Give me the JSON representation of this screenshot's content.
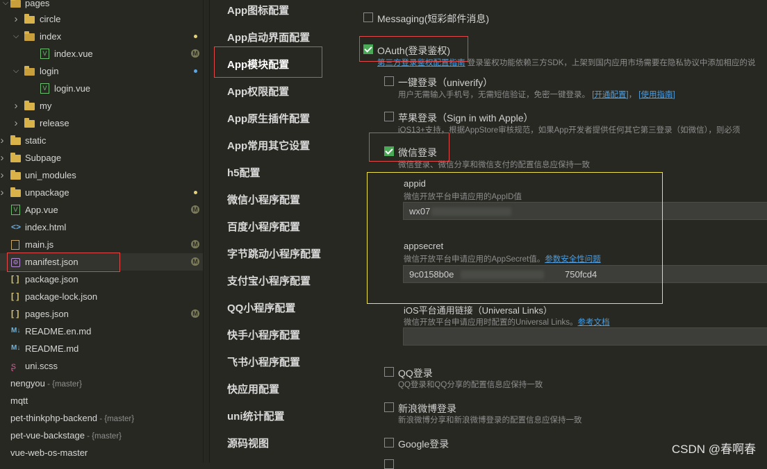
{
  "tree": {
    "items": [
      {
        "label": "pages",
        "icon": "folder-icon",
        "arrow": "chevron-down-icon",
        "open": true
      },
      {
        "label": "circle",
        "icon": "folder-icon",
        "arrow": "chevron-right-icon"
      },
      {
        "label": "index",
        "icon": "folder-icon",
        "arrow": "chevron-down-icon",
        "open": true
      },
      {
        "label": "index.vue",
        "icon": "vue-file-icon",
        "badge": "M"
      },
      {
        "label": "login",
        "icon": "folder-icon",
        "arrow": "chevron-down-icon",
        "open": true
      },
      {
        "label": "login.vue",
        "icon": "vue-file-icon"
      },
      {
        "label": "my",
        "icon": "folder-icon",
        "arrow": "chevron-right-icon"
      },
      {
        "label": "release",
        "icon": "folder-icon",
        "arrow": "chevron-right-icon"
      },
      {
        "label": "static",
        "icon": "folder-icon",
        "arrow": "chevron-right-icon"
      },
      {
        "label": "Subpage",
        "icon": "folder-icon",
        "arrow": "chevron-right-icon"
      },
      {
        "label": "uni_modules",
        "icon": "folder-icon",
        "arrow": "chevron-right-icon"
      },
      {
        "label": "unpackage",
        "icon": "folder-icon",
        "arrow": "chevron-right-icon"
      },
      {
        "label": "App.vue",
        "icon": "vue-file-icon",
        "badge": "M"
      },
      {
        "label": "index.html",
        "icon": "html-file-icon"
      },
      {
        "label": "main.js",
        "icon": "js-file-icon",
        "badge": "M"
      },
      {
        "label": "manifest.json",
        "icon": "manifest-file-icon",
        "badge": "M"
      },
      {
        "label": "package.json",
        "icon": "json-file-icon"
      },
      {
        "label": "package-lock.json",
        "icon": "json-file-icon"
      },
      {
        "label": "pages.json",
        "icon": "json-file-icon",
        "badge": "M"
      },
      {
        "label": "README.en.md",
        "icon": "markdown-file-icon"
      },
      {
        "label": "README.md",
        "icon": "markdown-file-icon"
      },
      {
        "label": "uni.scss",
        "icon": "scss-file-icon"
      },
      {
        "label": "nengyou",
        "branch": "- {master}",
        "icon": "project-folder-icon"
      },
      {
        "label": "mqtt",
        "icon": "project-folder-icon"
      },
      {
        "label": "pet-thinkphp-backend",
        "branch": "- {master}",
        "icon": "project-folder-icon"
      },
      {
        "label": "pet-vue-backstage",
        "branch": "- {master}",
        "icon": "project-folder-icon"
      },
      {
        "label": "vue-web-os-master",
        "icon": "project-folder-icon"
      }
    ]
  },
  "nav": {
    "items": [
      "App图标配置",
      "App启动界面配置",
      "App模块配置",
      "App权限配置",
      "App原生插件配置",
      "App常用其它设置",
      "h5配置",
      "微信小程序配置",
      "百度小程序配置",
      "字节跳动小程序配置",
      "支付宝小程序配置",
      "QQ小程序配置",
      "快手小程序配置",
      "飞书小程序配置",
      "快应用配置",
      "uni统计配置",
      "源码视图"
    ],
    "active": "App模块配置"
  },
  "content": {
    "messaging": {
      "label": "Messaging(短彩邮件消息)",
      "checked": false
    },
    "oauth": {
      "label": "OAuth(登录鉴权)",
      "checked": true,
      "desc_link": "第三方登录鉴权配置指南",
      "desc": "登录鉴权功能依赖三方SDK，上架到国内应用市场需要在隐私协议中添加相应的说"
    },
    "univerify": {
      "label": "一键登录（univerify）",
      "checked": false,
      "desc": "用户无需输入手机号，无需短信验证，免密一键登录。",
      "link1": "[开通配置]",
      "sep": "，",
      "link2": "[使用指南]"
    },
    "apple": {
      "label": "苹果登录（Sign in with Apple）",
      "checked": false,
      "desc": "iOS13+支持，根据AppStore审核规范，如果App开发者提供任何其它第三登录（如微信），则必须"
    },
    "weixin": {
      "label": "微信登录",
      "checked": true,
      "desc": "微信登录、微信分享和微信支付的配置信息应保持一致",
      "appid_label": "appid",
      "appid_desc": "微信开放平台申请应用的AppID值",
      "appid_value": "wx07",
      "appsecret_label": "appsecret",
      "appsecret_desc": "微信开放平台申请应用的AppSecret值。",
      "appsecret_link": "参数安全性问题",
      "appsecret_value_start": "9c0158b0e",
      "appsecret_value_end": "750fcd4",
      "ul_label": "iOS平台通用链接（Universal Links）",
      "ul_desc": "微信开放平台申请应用时配置的Universal Links。",
      "ul_link": "参考文档",
      "ul_value": ""
    },
    "qq": {
      "label": "QQ登录",
      "checked": false,
      "desc": "QQ登录和QQ分享的配置信息应保持一致"
    },
    "sina": {
      "label": "新浪微博登录",
      "checked": false,
      "desc": "新浪微博分享和新浪微博登录的配置信息应保持一致"
    },
    "google": {
      "label": "Google登录",
      "checked": false
    }
  },
  "watermark": "CSDN @春啊春"
}
